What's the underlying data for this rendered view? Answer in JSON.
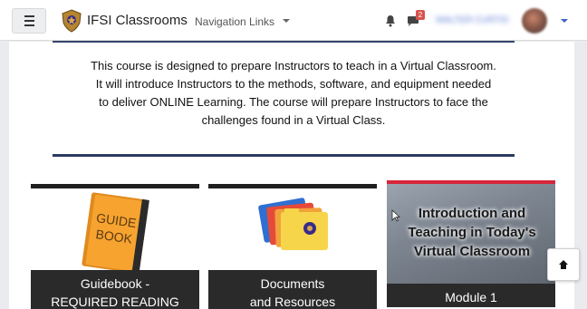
{
  "navbar": {
    "site_name": "IFSI Classrooms",
    "nav_links_label": "Navigation Links",
    "message_count": "2",
    "user_name": "WALTER CURTIS",
    "icons": {
      "menu": "hamburger-menu-icon",
      "logo": "ifsi-shield-logo",
      "notifications": "bell-icon",
      "messages": "chat-bubble-icon"
    }
  },
  "course": {
    "description_lines": [
      "This course is designed to prepare Instructors to teach in a Virtual Classroom.",
      "It will introduce Instructors to the methods, software, and equipment needed",
      "to deliver ONLINE Learning.  The course will prepare Instructors to face the",
      "challenges found in a Virtual Class."
    ]
  },
  "cards": [
    {
      "line1": "Guidebook -",
      "line2": "REQUIRED READING",
      "image_text": [
        "GUIDE",
        "BOOK"
      ],
      "icon": "guidebook-icon"
    },
    {
      "line1": "Documents",
      "line2": "and Resources",
      "icon": "folders-icon"
    },
    {
      "title_lines": [
        "Introduction and",
        "Teaching in Today's",
        "Virtual Classroom"
      ],
      "footer": "Module 1",
      "accent_color": "#d6263a"
    }
  ],
  "colors": {
    "divider": "#2b3a63",
    "card_footer": "#2a2a2a",
    "badge": "#d9534f",
    "user_link": "#3a63c9"
  }
}
